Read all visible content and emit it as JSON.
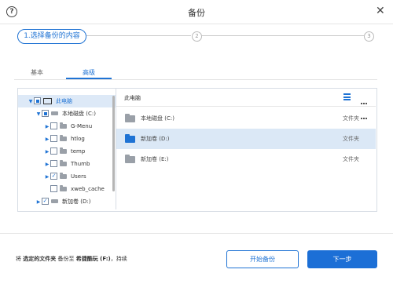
{
  "window": {
    "title": "备份"
  },
  "steps": [
    {
      "label": "1.选择备份的内容"
    },
    {
      "label": "2"
    },
    {
      "label": "3"
    }
  ],
  "tabs": [
    {
      "label": "基本",
      "active": false
    },
    {
      "label": "高级",
      "active": true
    }
  ],
  "tree": {
    "items": [
      {
        "label": "此电脑",
        "check": "partial",
        "selected": true
      },
      {
        "label": "本地磁盘 (C:)",
        "check": "partial"
      },
      {
        "label": "G-Menu",
        "check": "none"
      },
      {
        "label": "htlog",
        "check": "none"
      },
      {
        "label": "temp",
        "check": "none"
      },
      {
        "label": "Thumb",
        "check": "none"
      },
      {
        "label": "Users",
        "check": "checked",
        "check_mark": "✓"
      },
      {
        "label": "xweb_cache",
        "check": "none"
      },
      {
        "label": "新加卷 (D:)",
        "check": "checked",
        "check_mark": "✓"
      }
    ]
  },
  "right": {
    "breadcrumb": "此电脑",
    "rows": [
      {
        "name": "本地磁盘 (C:)",
        "type": "文件夹",
        "selected": false
      },
      {
        "name": "新加卷 (D:)",
        "type": "文件夹",
        "selected": true
      },
      {
        "name": "新加卷 (E:)",
        "type": "文件夹",
        "selected": false
      }
    ]
  },
  "footer": {
    "prefix": "将",
    "bold1": "选定的文件夹",
    "mid": "备份至",
    "bold2": "希捷酷玩 (F:)",
    "suffix": "，持续",
    "start_backup": "开始备份",
    "next": "下一步"
  },
  "colors": {
    "accent": "#1f73d4",
    "folder_blue": "#1f73d4",
    "folder_gray": "#9aa0a8"
  }
}
